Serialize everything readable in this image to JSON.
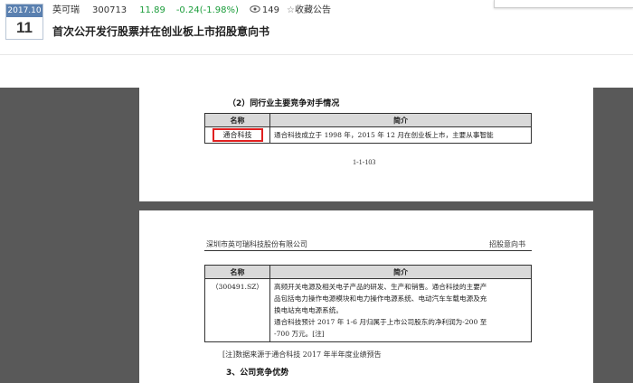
{
  "header": {
    "date_year_month": "2017.10",
    "date_day": "11",
    "stock_name": "英可瑞",
    "stock_code": "300713",
    "price": "11.89",
    "change": "-0.24(-1.98%)",
    "views": "149",
    "favorite_label": "收藏公告",
    "document_title": "首次公开发行股票并在创业板上市招股意向书",
    "colors": {
      "change_color": "#1a9c3a",
      "date_badge": "#5a80b0"
    }
  },
  "page1": {
    "section_heading": "（2）同行业主要竞争对手情况",
    "table": {
      "col_name": "名称",
      "col_intro": "简介",
      "row_name": "通合科技",
      "row_intro": "通合科技成立于 1998 年，2015 年 12 月在创业板上市，主要从事智能"
    },
    "page_number": "1-1-103"
  },
  "page2": {
    "running_left": "深圳市英可瑞科技股份有限公司",
    "running_right": "招股意向书",
    "table": {
      "col_name": "名称",
      "col_intro": "简介",
      "row_name": "（300491.SZ）",
      "intro_lines": [
        "高频开关电源及相关电子产品的研发、生产和销售。通合科技的主要产",
        "品包括电力操作电源模块和电力操作电源系统、电动汽车车载电源及充",
        "换电站充电电源系统。",
        "通合科技预计 2017 年 1-6 月归属于上市公司股东的净利润为-200 至",
        "-700 万元。[注]"
      ]
    },
    "note": "[注]数据来源于通合科技 2017 年半年度业绩预告",
    "section_heading": "3、公司竞争优势"
  }
}
